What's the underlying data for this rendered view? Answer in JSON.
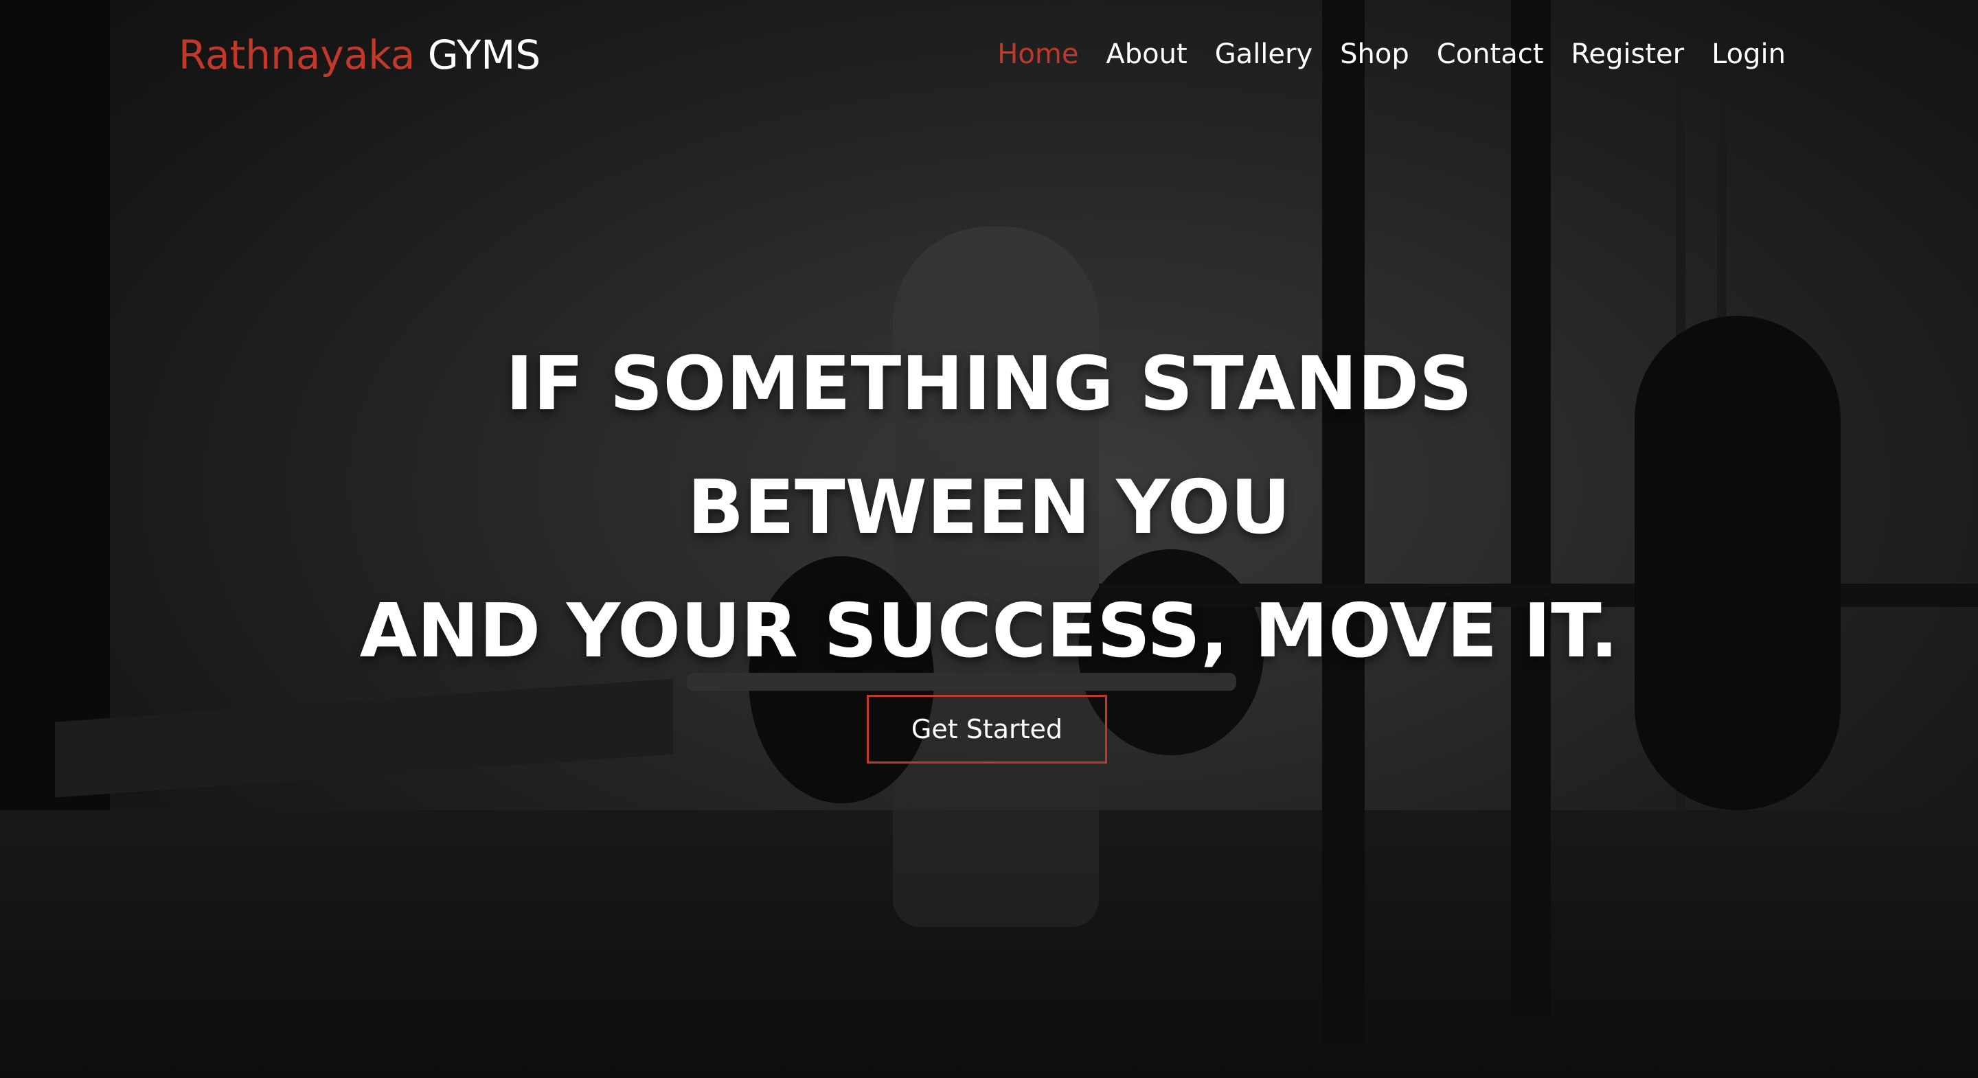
{
  "header": {
    "logo_part1": "Rathnayaka",
    "logo_part2": "GYMS",
    "nav": [
      {
        "label": "Home",
        "active": true
      },
      {
        "label": "About"
      },
      {
        "label": "Gallery"
      },
      {
        "label": "Shop"
      },
      {
        "label": "Contact"
      },
      {
        "label": "Register"
      },
      {
        "label": "Login"
      }
    ]
  },
  "hero": {
    "headline_line1": "IF SOMETHING STANDS",
    "headline_line2": "BETWEEN YOU",
    "headline_line3": "AND YOUR SUCCESS, MOVE IT.",
    "cta_label": "Get Started"
  },
  "colors": {
    "accent": "#c0392b",
    "text": "#ffffff"
  }
}
